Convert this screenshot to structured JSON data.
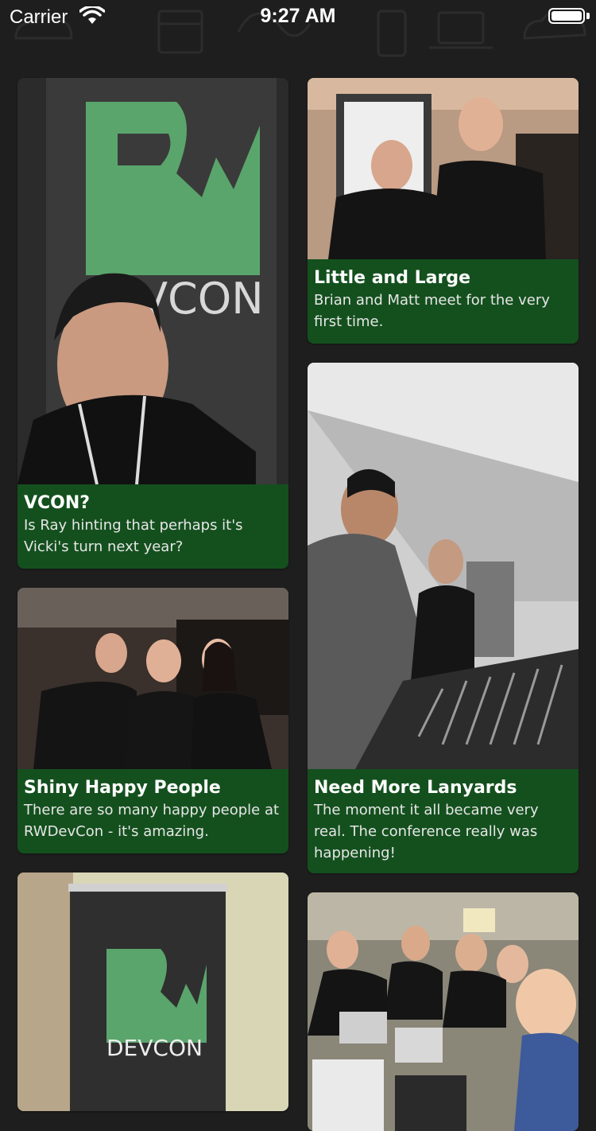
{
  "status_bar": {
    "carrier": "Carrier",
    "time": "9:27 AM",
    "battery_level": 1.0
  },
  "colors": {
    "background": "#1e1e1e",
    "caption_background": "#14501e",
    "rw_green": "#5aa56c"
  },
  "photos": [
    {
      "title": "VCON?",
      "comment": "Is Ray hinting that perhaps it's Vicki's turn next year?",
      "banner_text": "EVCON"
    },
    {
      "title": "Little and Large",
      "comment": "Brian and Matt meet for the very first time."
    },
    {
      "title": "Need More Lanyards",
      "comment": "The moment it all became very real. The conference really was happening!"
    },
    {
      "title": "Shiny Happy People",
      "comment": "There are so many happy people at RWDevCon - it's amazing."
    },
    {
      "title": "",
      "comment": "",
      "banner_text": "DEVCON"
    },
    {
      "title": "",
      "comment": ""
    }
  ]
}
